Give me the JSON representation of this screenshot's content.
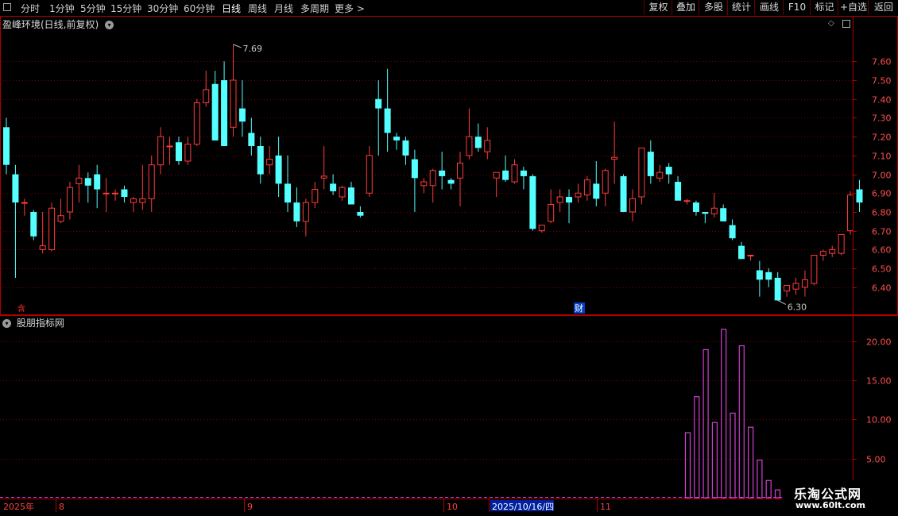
{
  "toolbar": {
    "periods": [
      "分时",
      "1分钟",
      "5分钟",
      "15分钟",
      "30分钟",
      "60分钟",
      "日线",
      "周线",
      "月线",
      "多周期",
      "更多 >"
    ],
    "active_period": "日线",
    "right_buttons": [
      "复权",
      "叠加",
      "多股",
      "统计",
      "画线",
      "F10",
      "标记",
      "+自选",
      "返回"
    ]
  },
  "main_title": "盈峰环境(日线,前复权)",
  "sub_title": "股朋指标网",
  "markers": {
    "bottom_left": "含",
    "fin": "财"
  },
  "colors": {
    "up": "#ff3b3b",
    "down": "#54ffff",
    "grid": "#7a0000",
    "axis": "#b00000",
    "indicator": "#d040d0",
    "ylabel": "#ff5050"
  },
  "chart_data": [
    {
      "type": "candlestick",
      "title": "盈峰环境(日线,前复权)",
      "y_ticks": [
        "7.60",
        "7.50",
        "7.40",
        "7.30",
        "7.20",
        "7.10",
        "7.00",
        "6.90",
        "6.80",
        "6.70",
        "6.60",
        "6.50",
        "6.40"
      ],
      "ylim": [
        6.26,
        7.77
      ],
      "high_annotation": "7.69",
      "low_annotation": "6.30",
      "x_labels": [
        "2025年",
        "8",
        "9",
        "10",
        "2025/10/16/四",
        "11"
      ],
      "ohlc": [
        [
          7.25,
          7.3,
          7.0,
          7.05
        ],
        [
          7.0,
          7.05,
          6.45,
          6.85
        ],
        [
          6.85,
          6.87,
          6.78,
          6.85
        ],
        [
          6.8,
          6.81,
          6.65,
          6.67
        ],
        [
          6.6,
          6.8,
          6.58,
          6.62
        ],
        [
          6.6,
          6.85,
          6.59,
          6.82
        ],
        [
          6.75,
          6.87,
          6.74,
          6.78
        ],
        [
          6.8,
          6.96,
          6.76,
          6.93
        ],
        [
          6.95,
          7.05,
          6.85,
          6.98
        ],
        [
          6.98,
          7.01,
          6.85,
          6.94
        ],
        [
          7.0,
          7.05,
          6.82,
          6.92
        ],
        [
          6.9,
          6.98,
          6.8,
          6.9
        ],
        [
          6.9,
          6.92,
          6.86,
          6.9
        ],
        [
          6.92,
          6.94,
          6.85,
          6.88
        ],
        [
          6.85,
          6.88,
          6.8,
          6.87
        ],
        [
          6.85,
          7.05,
          6.81,
          6.87
        ],
        [
          6.87,
          7.1,
          6.8,
          7.05
        ],
        [
          7.05,
          7.25,
          7.0,
          7.2
        ],
        [
          7.15,
          7.2,
          7.05,
          7.15
        ],
        [
          7.17,
          7.2,
          7.05,
          7.07
        ],
        [
          7.07,
          7.2,
          7.05,
          7.16
        ],
        [
          7.16,
          7.4,
          7.15,
          7.38
        ],
        [
          7.38,
          7.55,
          7.36,
          7.45
        ],
        [
          7.48,
          7.55,
          7.3,
          7.18
        ],
        [
          7.5,
          7.6,
          7.44,
          7.15
        ],
        [
          7.25,
          7.69,
          7.2,
          7.5
        ],
        [
          7.35,
          7.5,
          7.2,
          7.28
        ],
        [
          7.22,
          7.3,
          7.1,
          7.15
        ],
        [
          7.15,
          7.2,
          6.95,
          7.0
        ],
        [
          7.05,
          7.15,
          7.0,
          7.08
        ],
        [
          7.1,
          7.2,
          6.88,
          6.95
        ],
        [
          6.95,
          7.1,
          6.8,
          6.85
        ],
        [
          6.85,
          6.93,
          6.72,
          6.75
        ],
        [
          6.75,
          6.87,
          6.67,
          6.85
        ],
        [
          6.85,
          6.96,
          6.82,
          6.92
        ],
        [
          6.98,
          7.15,
          6.92,
          6.99
        ],
        [
          6.95,
          7.0,
          6.89,
          6.91
        ],
        [
          6.88,
          6.94,
          6.86,
          6.93
        ],
        [
          6.93,
          6.96,
          6.85,
          6.84
        ],
        [
          6.8,
          6.83,
          6.77,
          6.78
        ],
        [
          6.9,
          7.15,
          6.88,
          7.1
        ],
        [
          7.4,
          7.5,
          7.1,
          7.35
        ],
        [
          7.35,
          7.56,
          7.12,
          7.22
        ],
        [
          7.2,
          7.22,
          7.13,
          7.18
        ],
        [
          7.18,
          7.2,
          7.05,
          7.1
        ],
        [
          7.08,
          7.13,
          6.8,
          6.98
        ],
        [
          6.94,
          6.98,
          6.9,
          6.96
        ],
        [
          6.94,
          7.03,
          6.85,
          7.02
        ],
        [
          7.02,
          7.12,
          6.92,
          6.99
        ],
        [
          6.97,
          6.98,
          6.92,
          6.95
        ],
        [
          6.98,
          7.12,
          6.83,
          7.06
        ],
        [
          7.1,
          7.35,
          7.08,
          7.2
        ],
        [
          7.2,
          7.27,
          7.12,
          7.14
        ],
        [
          7.12,
          7.25,
          7.08,
          7.18
        ],
        [
          6.98,
          7.0,
          6.88,
          7.01
        ],
        [
          7.02,
          7.1,
          6.96,
          6.97
        ],
        [
          6.96,
          7.08,
          6.95,
          7.05
        ],
        [
          7.02,
          7.04,
          6.92,
          6.99
        ],
        [
          6.99,
          7.0,
          6.7,
          6.71
        ],
        [
          6.7,
          6.73,
          6.69,
          6.73
        ],
        [
          6.75,
          6.92,
          6.74,
          6.84
        ],
        [
          6.85,
          6.92,
          6.8,
          6.88
        ],
        [
          6.88,
          6.92,
          6.74,
          6.85
        ],
        [
          6.88,
          6.95,
          6.85,
          6.9
        ],
        [
          6.89,
          6.99,
          6.86,
          6.97
        ],
        [
          6.95,
          7.07,
          6.83,
          6.87
        ],
        [
          6.9,
          7.03,
          6.83,
          7.02
        ],
        [
          7.08,
          7.28,
          6.95,
          7.09
        ],
        [
          6.99,
          7.0,
          6.8,
          6.8
        ],
        [
          6.8,
          6.92,
          6.75,
          6.87
        ],
        [
          6.88,
          7.13,
          6.84,
          7.14
        ],
        [
          7.12,
          7.18,
          6.95,
          6.99
        ],
        [
          6.98,
          7.05,
          6.96,
          7.01
        ],
        [
          7.04,
          7.06,
          6.95,
          7.0
        ],
        [
          6.96,
          6.99,
          6.87,
          6.86
        ],
        [
          6.86,
          6.87,
          6.84,
          6.86
        ],
        [
          6.85,
          6.86,
          6.78,
          6.8
        ],
        [
          6.8,
          6.8,
          6.74,
          6.79
        ],
        [
          6.79,
          6.9,
          6.77,
          6.82
        ],
        [
          6.82,
          6.84,
          6.75,
          6.75
        ],
        [
          6.73,
          6.76,
          6.65,
          6.66
        ],
        [
          6.62,
          6.64,
          6.55,
          6.55
        ],
        [
          6.57,
          6.57,
          6.54,
          6.57
        ],
        [
          6.49,
          6.54,
          6.35,
          6.44
        ],
        [
          6.48,
          6.5,
          6.4,
          6.44
        ],
        [
          6.45,
          6.48,
          6.33,
          6.33
        ],
        [
          6.38,
          6.4,
          6.35,
          6.41
        ],
        [
          6.39,
          6.45,
          6.36,
          6.42
        ],
        [
          6.4,
          6.49,
          6.35,
          6.44
        ],
        [
          6.42,
          6.56,
          6.41,
          6.57
        ],
        [
          6.57,
          6.6,
          6.54,
          6.59
        ],
        [
          6.58,
          6.62,
          6.56,
          6.6
        ],
        [
          6.58,
          6.68,
          6.57,
          6.68
        ],
        [
          6.7,
          6.91,
          6.68,
          6.89
        ],
        [
          6.92,
          6.97,
          6.8,
          6.85
        ]
      ]
    },
    {
      "type": "bar",
      "title": "股朋指标网",
      "y_ticks": [
        "20.00",
        "15.00",
        "10.00",
        "5.00"
      ],
      "ylim": [
        0,
        23
      ],
      "values": [
        8.3,
        12.9,
        18.9,
        9.6,
        21.5,
        10.8,
        19.4,
        9.0,
        4.8,
        2.2,
        1.0
      ]
    }
  ]
}
